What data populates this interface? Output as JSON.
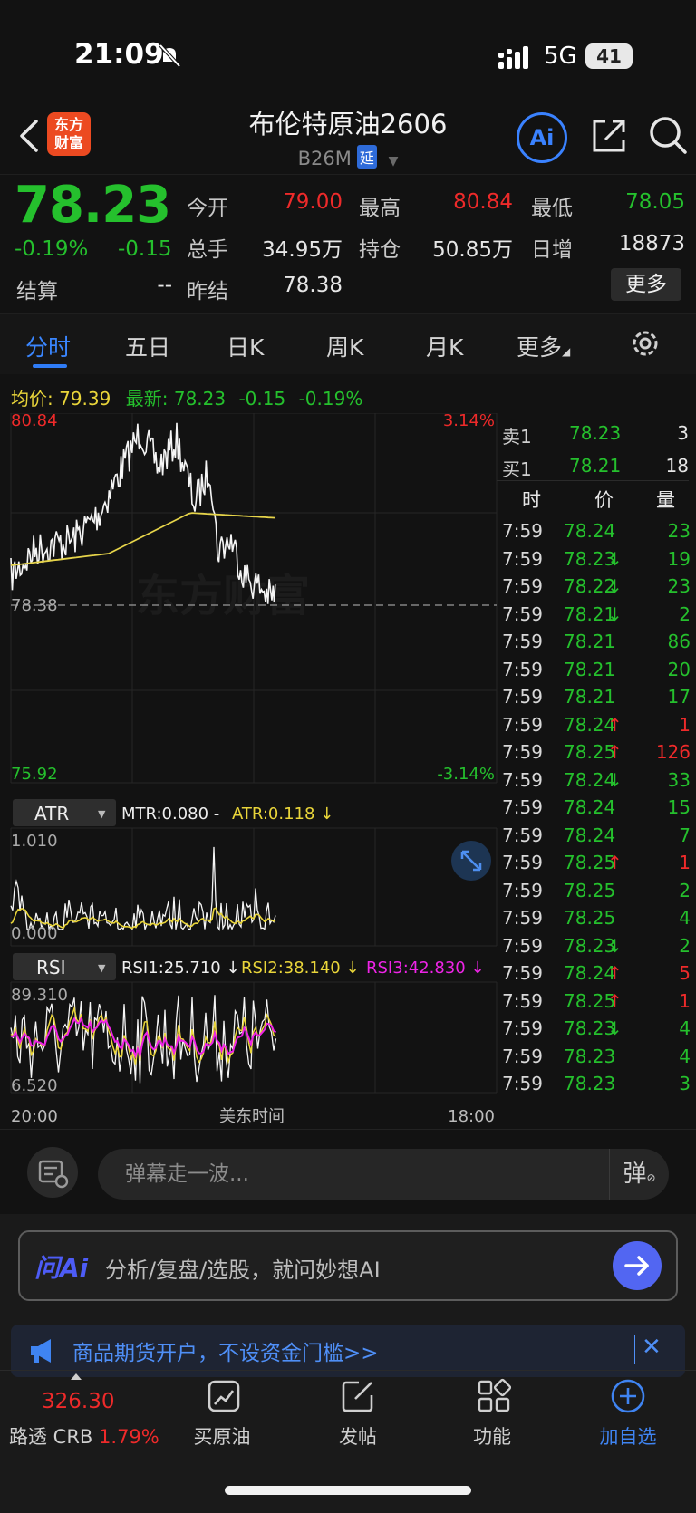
{
  "status_bar": {
    "time": "21:09",
    "network": "5G",
    "battery": "41"
  },
  "header": {
    "brand_line1": "东方",
    "brand_line2": "财富",
    "title": "布伦特原油2606",
    "subtitle": "B26M",
    "delay_badge": "延",
    "ai_label": "Ai"
  },
  "quote": {
    "price": "78.23",
    "pct_change": "-0.19%",
    "abs_change": "-0.15",
    "settle_label": "结算",
    "settle_value": "--",
    "fields": [
      {
        "label": "今开",
        "value": "79.00",
        "color": "#ee2a2a"
      },
      {
        "label": "最高",
        "value": "80.84",
        "color": "#ee2a2a"
      },
      {
        "label": "最低",
        "value": "78.05",
        "color": "#25c02d"
      },
      {
        "label": "总手",
        "value": "34.95万",
        "color": "#e6e6e6"
      },
      {
        "label": "持仓",
        "value": "50.85万",
        "color": "#e6e6e6"
      },
      {
        "label": "日增",
        "value": "18873",
        "color": "#e6e6e6"
      },
      {
        "label": "昨结",
        "value": "78.38",
        "color": "#e6e6e6"
      }
    ],
    "more_label": "更多"
  },
  "tabs": [
    "分时",
    "五日",
    "日K",
    "周K",
    "月K",
    "更多"
  ],
  "avg_line": {
    "avg_label": "均价:",
    "avg_value": "79.39",
    "last_label": "最新:",
    "last_value": "78.23",
    "change": "-0.15",
    "pct": "-0.19%"
  },
  "chart_data": {
    "type": "line",
    "price_axis": {
      "high": "80.84",
      "mid": "78.38",
      "low": "75.92",
      "high_pct": "3.14%",
      "low_pct": "-3.14%"
    },
    "x_axis": {
      "start": "20:00",
      "label": "美东时间",
      "end": "18:00"
    },
    "atr_panel": {
      "selector": "ATR",
      "legend_mtr": "MTR:0.080 -",
      "legend_atr": "ATR:0.118 ↓",
      "top": "1.010",
      "bottom": "0.000"
    },
    "rsi_panel": {
      "selector": "RSI",
      "rsi1": "RSI1:25.710 ↓",
      "rsi2": "RSI2:38.140 ↓",
      "rsi3": "RSI3:42.830 ↓",
      "top": "89.310",
      "bottom": "6.520"
    },
    "watermark": "东方财富"
  },
  "order_book": [
    {
      "label": "卖1",
      "price": "78.23",
      "qty": "3"
    },
    {
      "label": "买1",
      "price": "78.21",
      "qty": "18"
    }
  ],
  "trades_header": {
    "time": "时",
    "price": "价",
    "qty": "量"
  },
  "trades": [
    {
      "t": "7:59",
      "p": "78.24",
      "a": "",
      "q": "23"
    },
    {
      "t": "7:59",
      "p": "78.23",
      "a": "↓",
      "q": "19"
    },
    {
      "t": "7:59",
      "p": "78.22",
      "a": "↓",
      "q": "23"
    },
    {
      "t": "7:59",
      "p": "78.21",
      "a": "↓",
      "q": "2"
    },
    {
      "t": "7:59",
      "p": "78.21",
      "a": "",
      "q": "86"
    },
    {
      "t": "7:59",
      "p": "78.21",
      "a": "",
      "q": "20"
    },
    {
      "t": "7:59",
      "p": "78.21",
      "a": "",
      "q": "17"
    },
    {
      "t": "7:59",
      "p": "78.24",
      "a": "↑",
      "q": "1"
    },
    {
      "t": "7:59",
      "p": "78.25",
      "a": "↑",
      "q": "126"
    },
    {
      "t": "7:59",
      "p": "78.24",
      "a": "↓",
      "q": "33"
    },
    {
      "t": "7:59",
      "p": "78.24",
      "a": "",
      "q": "15"
    },
    {
      "t": "7:59",
      "p": "78.24",
      "a": "",
      "q": "7"
    },
    {
      "t": "7:59",
      "p": "78.25",
      "a": "↑",
      "q": "1"
    },
    {
      "t": "7:59",
      "p": "78.25",
      "a": "",
      "q": "2"
    },
    {
      "t": "7:59",
      "p": "78.25",
      "a": "",
      "q": "4"
    },
    {
      "t": "7:59",
      "p": "78.23",
      "a": "↓",
      "q": "2"
    },
    {
      "t": "7:59",
      "p": "78.24",
      "a": "↑",
      "q": "5"
    },
    {
      "t": "7:59",
      "p": "78.25",
      "a": "↑",
      "q": "1"
    },
    {
      "t": "7:59",
      "p": "78.23",
      "a": "↓",
      "q": "4"
    },
    {
      "t": "7:59",
      "p": "78.23",
      "a": "",
      "q": "4"
    },
    {
      "t": "7:59",
      "p": "78.23",
      "a": "",
      "q": "3"
    }
  ],
  "danmaku": {
    "placeholder": "弹幕走一波...",
    "send_label": "弹"
  },
  "ai_box": {
    "logo": "问Ai",
    "placeholder": "分析/复盘/选股，就问妙想AI"
  },
  "promo": {
    "text": "商品期货开户，不设资金门槛>>"
  },
  "bottom_nav": {
    "crb_value": "326.30",
    "crb_label": "路透 CRB",
    "crb_pct": "1.79%",
    "items": [
      "买原油",
      "发帖",
      "功能",
      "加自选"
    ]
  },
  "colors": {
    "up": "#ee2a2a",
    "down": "#25c02d",
    "accent": "#2f7cf6",
    "avg": "#e9d53a"
  }
}
